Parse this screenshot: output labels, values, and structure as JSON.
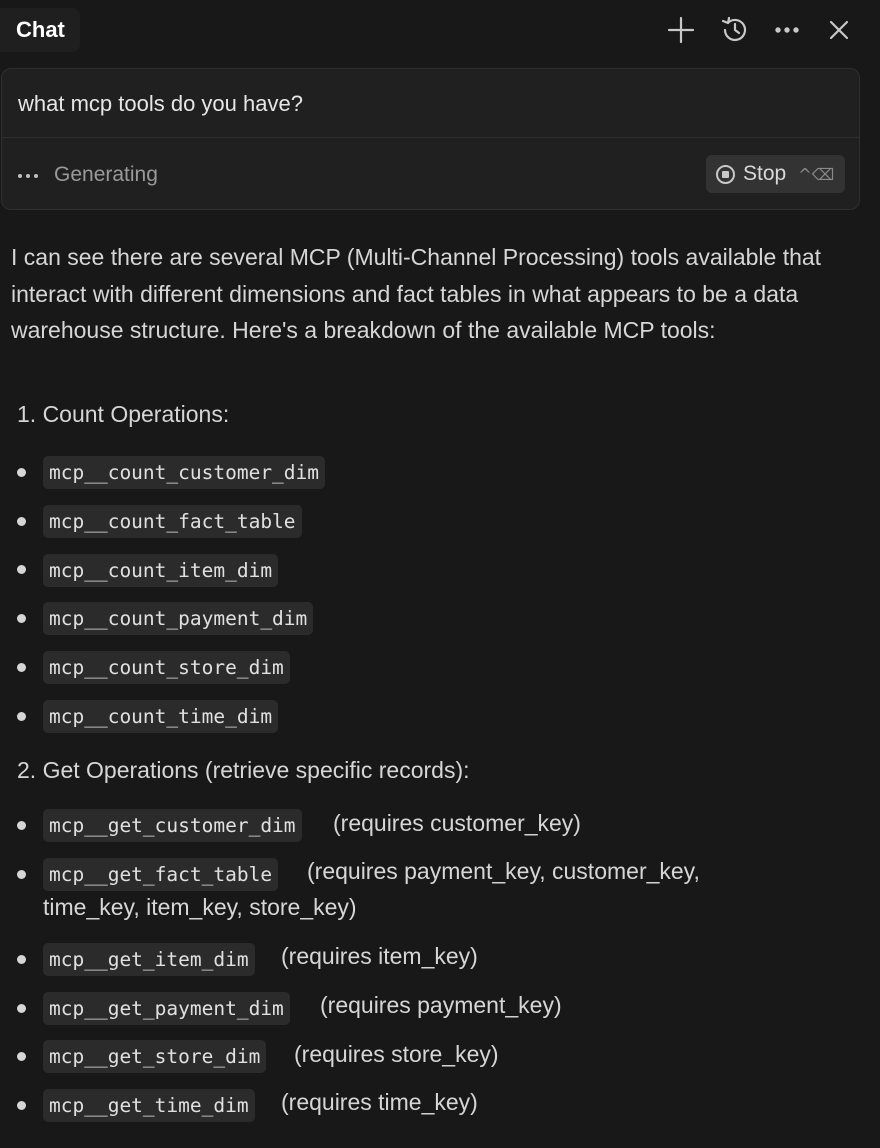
{
  "header": {
    "tab_label": "Chat",
    "icons": [
      "plus-icon",
      "history-icon",
      "more-icon",
      "close-icon"
    ]
  },
  "input": {
    "query": "what mcp tools do you have?",
    "status": "Generating",
    "stop_label": "Stop",
    "stop_shortcut": "^⌫"
  },
  "response": {
    "intro": "I can see there are several MCP (Multi-Channel Processing) tools available that interact with different dimensions and fact tables in what appears to be a data warehouse structure. Here's a breakdown of the available MCP tools:",
    "sections": [
      {
        "heading": "1. Count Operations:",
        "items": [
          {
            "code": "mcp__count_customer_dim",
            "note": ""
          },
          {
            "code": "mcp__count_fact_table",
            "note": ""
          },
          {
            "code": "mcp__count_item_dim",
            "note": ""
          },
          {
            "code": "mcp__count_payment_dim",
            "note": ""
          },
          {
            "code": "mcp__count_store_dim",
            "note": ""
          },
          {
            "code": "mcp__count_time_dim",
            "note": ""
          }
        ]
      },
      {
        "heading": "2. Get Operations (retrieve specific records):",
        "items": [
          {
            "code": "mcp__get_customer_dim",
            "note": "(requires customer_key)"
          },
          {
            "code": "mcp__get_fact_table",
            "note": "(requires payment_key, customer_key,",
            "note_line2": "time_key, item_key, store_key)"
          },
          {
            "code": "mcp__get_item_dim",
            "note": "(requires item_key)"
          },
          {
            "code": "mcp__get_payment_dim",
            "note": "(requires payment_key)"
          },
          {
            "code": "mcp__get_store_dim",
            "note": "(requires store_key)"
          },
          {
            "code": "mcp__get_time_dim",
            "note": "(requires time_key)"
          }
        ]
      }
    ]
  }
}
